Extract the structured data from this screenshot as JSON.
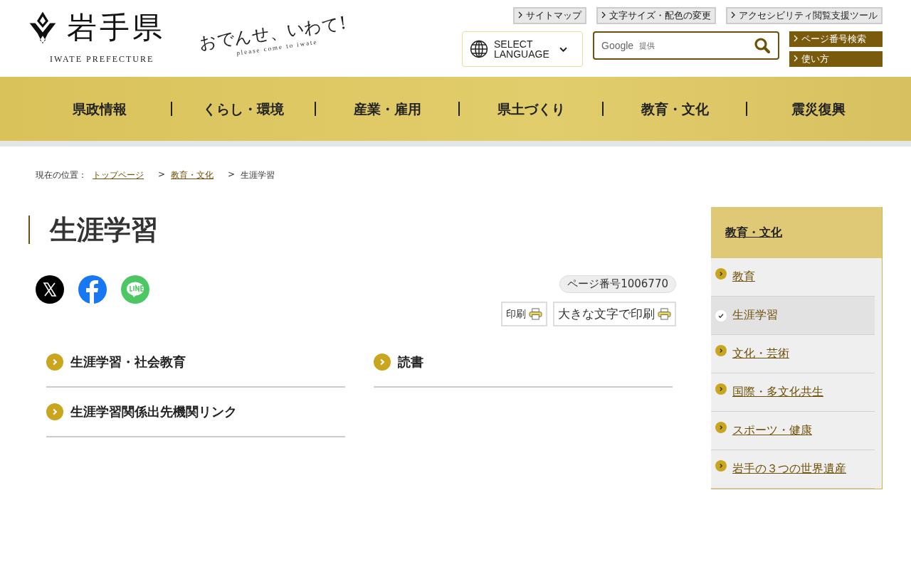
{
  "header": {
    "logo_title": "岩手県",
    "logo_subtitle": "IWATE PREFECTURE",
    "tagline": "おでんせ、いわて!",
    "tagline_sub": "please come to iwate"
  },
  "utility_links": [
    "サイトマップ",
    "文字サイズ・配色の変更",
    "アクセシビリティ閲覧支援ツール"
  ],
  "language": {
    "label": "SELECT LANGUAGE"
  },
  "search": {
    "brand": "Google",
    "provided": "提供"
  },
  "side_buttons": [
    "ページ番号検索",
    "使い方"
  ],
  "nav": [
    "県政情報",
    "くらし・環境",
    "産業・雇用",
    "県土づくり",
    "教育・文化",
    "震災復興"
  ],
  "breadcrumb": {
    "label": "現在の位置：",
    "separator": ">",
    "items": [
      {
        "text": "トップページ",
        "kind": "link"
      },
      {
        "text": "教育・文化",
        "kind": "link"
      },
      {
        "text": "生涯学習",
        "kind": "current"
      }
    ]
  },
  "title": "生涯学習",
  "social": [
    {
      "kind": "x"
    },
    {
      "kind": "facebook"
    },
    {
      "kind": "line"
    }
  ],
  "page_number": "ページ番号1006770",
  "print_buttons": [
    "印刷",
    "大きな文字で印刷"
  ],
  "links": [
    "生涯学習・社会教育",
    "読書",
    "生涯学習関係出先機関リンク"
  ],
  "sidebar": {
    "heading": "教育・文化",
    "items": [
      {
        "label": "教育",
        "selected": false
      },
      {
        "label": "生涯学習",
        "selected": true
      },
      {
        "label": "文化・芸術",
        "selected": false
      },
      {
        "label": "国際・多文化共生",
        "selected": false
      },
      {
        "label": "スポーツ・健康",
        "selected": false
      },
      {
        "label": "岩手の３つの世界遺産",
        "selected": false
      }
    ]
  }
}
